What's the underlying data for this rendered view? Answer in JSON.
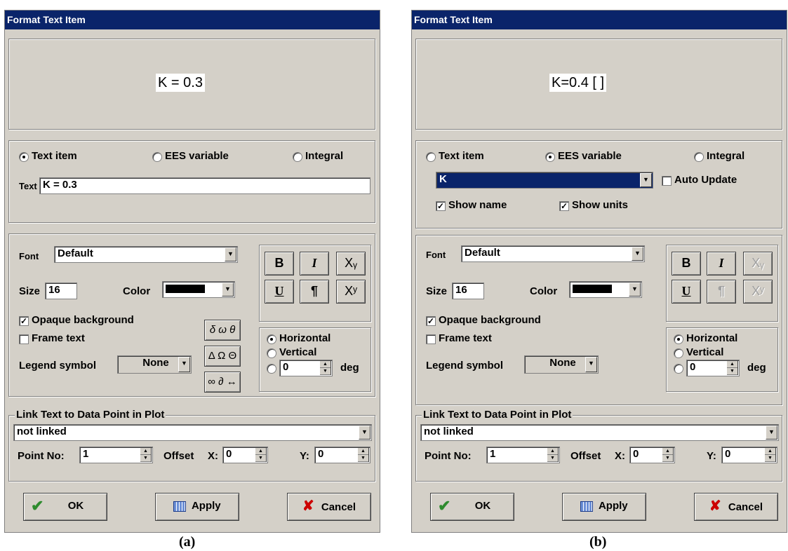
{
  "dialogs": [
    {
      "title": "Format Text Item",
      "preview_text": "K = 0.3",
      "radios": {
        "text_item": "Text item",
        "ees_variable": "EES variable",
        "integral": "Integral",
        "selected": "text_item"
      },
      "text_label": "Text",
      "text_value": "K = 0.3",
      "font_label": "Font",
      "font_value": "Default",
      "size_label": "Size",
      "size_value": "16",
      "color_label": "Color",
      "color_value": "#000000",
      "bold_label": "B",
      "italic_label": "I",
      "subscript_label": "Xᵧ",
      "underline_label": "U",
      "pilcrow_label": "¶",
      "superscript_label": "Xʸ",
      "opaque_label": "Opaque background",
      "opaque_checked": true,
      "frame_label": "Frame text",
      "frame_checked": false,
      "legend_label": "Legend symbol",
      "legend_value": "None",
      "greek_lower": "δ ω θ",
      "greek_upper": "Δ Ω Θ",
      "math_symbols": "∞ ∂ ↔",
      "orientation": {
        "horizontal": "Horizontal",
        "vertical": "Vertical",
        "deg_value": "0",
        "deg_label": "deg",
        "selected": "horizontal"
      },
      "link_title": "Link Text to Data Point in Plot",
      "link_value": "not linked",
      "point_label": "Point No:",
      "point_value": "1",
      "offset_label": "Offset",
      "x_label": "X:",
      "x_value": "0",
      "y_label": "Y:",
      "y_value": "0",
      "ok_label": "OK",
      "apply_label": "Apply",
      "cancel_label": "Cancel",
      "caption": "(a)"
    },
    {
      "title": "Format Text Item",
      "preview_text": "K=0.4 [ ]",
      "radios": {
        "text_item": "Text item",
        "ees_variable": "EES variable",
        "integral": "Integral",
        "selected": "ees_variable"
      },
      "variable_value": "K",
      "auto_update_label": "Auto Update",
      "auto_update_checked": false,
      "show_name_label": "Show  name",
      "show_name_checked": true,
      "show_units_label": "Show units",
      "show_units_checked": true,
      "font_label": "Font",
      "font_value": "Default",
      "size_label": "Size",
      "size_value": "16",
      "color_label": "Color",
      "color_value": "#000000",
      "bold_label": "B",
      "italic_label": "I",
      "subscript_label": "Xᵧ",
      "underline_label": "U",
      "pilcrow_label": "¶",
      "superscript_label": "Xʸ",
      "opaque_label": "Opaque background",
      "opaque_checked": true,
      "frame_label": "Frame text",
      "frame_checked": false,
      "legend_label": "Legend symbol",
      "legend_value": "None",
      "orientation": {
        "horizontal": "Horizontal",
        "vertical": "Vertical",
        "deg_value": "0",
        "deg_label": "deg",
        "selected": "horizontal"
      },
      "link_title": "Link Text to Data Point in Plot",
      "link_value": "not linked",
      "point_label": "Point No:",
      "point_value": "1",
      "offset_label": "Offset",
      "x_label": "X:",
      "x_value": "0",
      "y_label": "Y:",
      "y_value": "0",
      "ok_label": "OK",
      "apply_label": "Apply",
      "cancel_label": "Cancel",
      "caption": "(b)"
    }
  ],
  "icons": {
    "ok": "checkmark-icon",
    "apply": "calculator-icon",
    "cancel": "red-x-icon",
    "dropdown": "chevron-down-icon",
    "spinner": "spinner-arrows-icon"
  },
  "colors": {
    "titlebar": "#0a246a",
    "dialog_bg": "#d4d0c8",
    "ok_check": "#2e8b2e",
    "cancel_x": "#cc0000"
  }
}
